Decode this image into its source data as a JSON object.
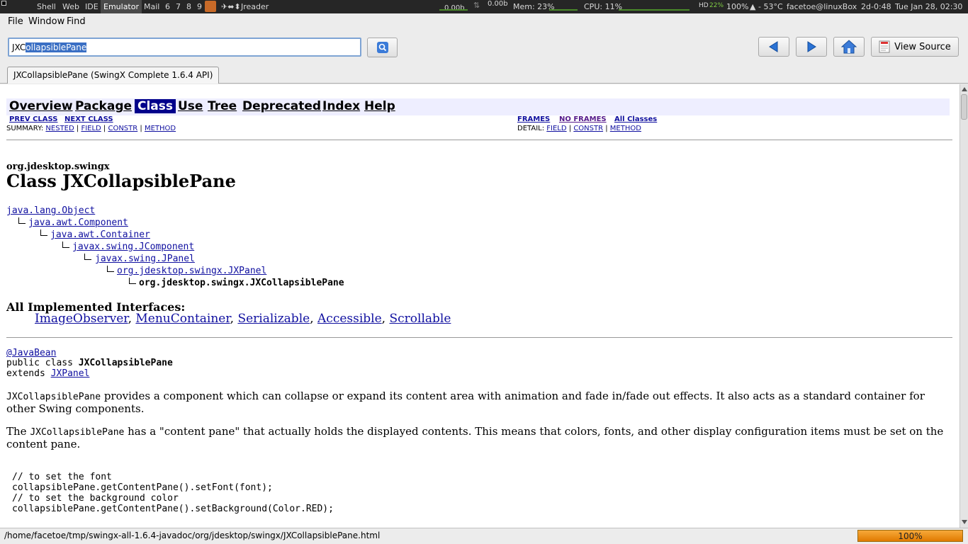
{
  "system_bar": {
    "workspaces": [
      "Shell",
      "Web",
      "IDE",
      "Emulator",
      "Mail",
      "6",
      "7",
      "8",
      "9"
    ],
    "active_workspace": "Emulator",
    "app_title": "Jreader",
    "net_down": "0.00b",
    "net_up": "0.00b",
    "mem": "Mem: 23%",
    "cpu": "CPU: 11%",
    "hd_label": "HD",
    "hd_value": "22%",
    "battery": "100%",
    "temp": "- 53°C",
    "user": "facetoe@linuxBox",
    "uptime": "2d-0:48",
    "clock": "Tue Jan 28, 02:30"
  },
  "menu": {
    "file": "File",
    "window": "Window",
    "find": "Find"
  },
  "toolbar": {
    "search_prefix": "JXC",
    "search_selected": "ollapsiblePane",
    "view_source": "View Source",
    "accent": "#3a6fc4"
  },
  "tab": {
    "title": "JXCollapsiblePane (SwingX Complete 1.6.4 API)"
  },
  "doc": {
    "nav": {
      "overview": "Overview",
      "package": "Package",
      "class": "Class",
      "use": "Use",
      "tree": "Tree",
      "deprecated": "Deprecated",
      "index": "Index",
      "help": "Help"
    },
    "prev_class": "PREV CLASS",
    "next_class": "NEXT CLASS",
    "frames": "FRAMES",
    "no_frames": "NO FRAMES",
    "all_classes": "All Classes",
    "summary_label": "SUMMARY:",
    "summary_links": [
      "NESTED",
      "FIELD",
      "CONSTR",
      "METHOD"
    ],
    "detail_label": "DETAIL:",
    "detail_links": [
      "FIELD",
      "CONSTR",
      "METHOD"
    ],
    "package": "org.jdesktop.swingx",
    "class_title": "Class JXCollapsiblePane",
    "hierarchy": [
      "java.lang.Object",
      "java.awt.Component",
      "java.awt.Container",
      "javax.swing.JComponent",
      "javax.swing.JPanel",
      "org.jdesktop.swingx.JXPanel",
      "org.jdesktop.swingx.JXCollapsiblePane"
    ],
    "interfaces_heading": "All Implemented Interfaces:",
    "interfaces": [
      "ImageObserver",
      "MenuContainer",
      "Serializable",
      "Accessible",
      "Scrollable"
    ],
    "annotation": "@JavaBean",
    "decl_public": "public class ",
    "decl_name": "JXCollapsiblePane",
    "decl_extends": "extends ",
    "decl_super": "JXPanel",
    "para1_code": "JXCollapsiblePane",
    "para1_text": " provides a component which can collapse or expand its content area with animation and fade in/fade out effects. It also acts as a standard container for other Swing components.",
    "para2_lead": "The ",
    "para2_code": "JXCollapsiblePane",
    "para2_text": " has a \"content pane\" that actually holds the displayed contents. This means that colors, fonts, and other display configuration items must be set on the content pane.",
    "code_lines": [
      "// to set the font",
      "collapsiblePane.getContentPane().setFont(font);",
      "// to set the background color",
      "collapsiblePane.getContentPane().setBackground(Color.RED);"
    ]
  },
  "status": {
    "path": "/home/facetoe/tmp/swingx-all-1.6.4-javadoc/org/jdesktop/swingx/JXCollapsiblePane.html",
    "progress_label": "100%",
    "progress_value": 100
  }
}
